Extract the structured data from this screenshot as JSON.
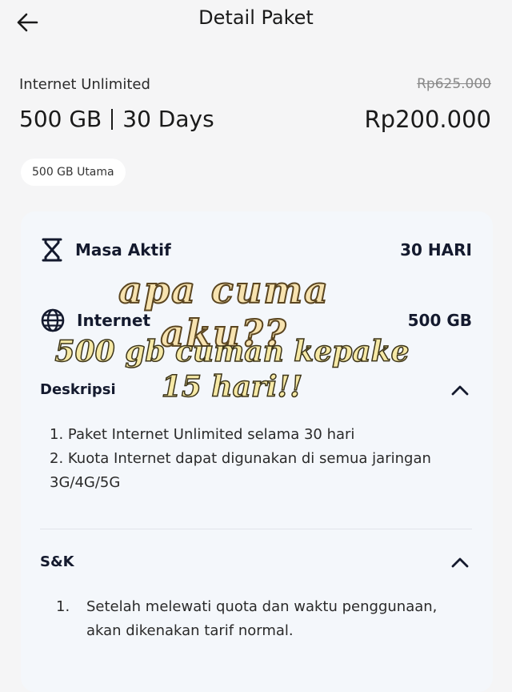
{
  "header": {
    "title": "Detail Paket",
    "back_icon": "arrow-left-icon"
  },
  "package": {
    "name": "Internet Unlimited",
    "original_price": "Rp625.000",
    "quota": "500 GB",
    "duration": "30 Days",
    "price": "Rp200.000",
    "chip": "500 GB Utama"
  },
  "details": {
    "masa_aktif": {
      "label": "Masa Aktif",
      "value": "30 HARI",
      "icon": "hourglass-icon"
    },
    "internet": {
      "label": "Internet",
      "value": "500 GB",
      "icon": "globe-icon"
    }
  },
  "deskripsi": {
    "title": "Deskripsi",
    "items": [
      "1. Paket Internet Unlimited selama 30 hari",
      "2. Kuota Internet dapat digunakan di semua jaringan 3G/4G/5G"
    ]
  },
  "snk": {
    "title": "S&K",
    "items": [
      {
        "num": "1.",
        "text": "Setelah melewati quota dan waktu penggunaan, akan dikenakan tarif normal."
      }
    ]
  },
  "overlay": {
    "line1": "apa cuma aku??",
    "line2": "500 gb cuman kepake",
    "line3": "15 hari!!"
  },
  "colors": {
    "background": "#f5f5f6",
    "card": "#f4f7fb",
    "text_dark": "#141a2e",
    "overlay_fill": "#f6e9a6"
  }
}
